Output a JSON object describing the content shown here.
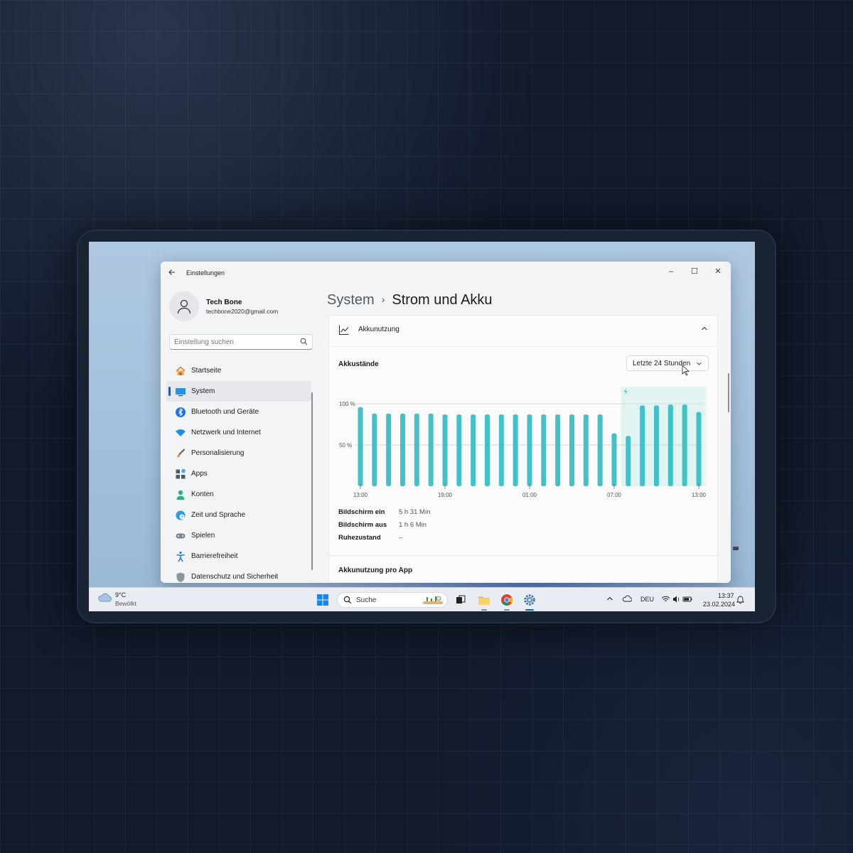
{
  "window": {
    "app_title": "Einstellungen",
    "controls": {
      "minimize": "–",
      "maximize": "☐",
      "close": "✕"
    }
  },
  "user": {
    "name": "Tech Bone",
    "email": "techbone2020@gmail.com"
  },
  "search": {
    "placeholder": "Einstellung suchen"
  },
  "sidebar": {
    "items": [
      {
        "label": "Startseite",
        "icon": "home-icon",
        "active": false
      },
      {
        "label": "System",
        "icon": "monitor-icon",
        "active": true
      },
      {
        "label": "Bluetooth und Geräte",
        "icon": "bluetooth-icon",
        "active": false
      },
      {
        "label": "Netzwerk und Internet",
        "icon": "wifi-icon",
        "active": false
      },
      {
        "label": "Personalisierung",
        "icon": "brush-icon",
        "active": false
      },
      {
        "label": "Apps",
        "icon": "apps-icon",
        "active": false
      },
      {
        "label": "Konten",
        "icon": "person-icon",
        "active": false
      },
      {
        "label": "Zeit und Sprache",
        "icon": "globe-clock-icon",
        "active": false
      },
      {
        "label": "Spielen",
        "icon": "gamepad-icon",
        "active": false
      },
      {
        "label": "Barrierefreiheit",
        "icon": "accessibility-icon",
        "active": false
      },
      {
        "label": "Datenschutz und Sicherheit",
        "icon": "shield-icon",
        "active": false
      }
    ]
  },
  "breadcrumb": {
    "parent": "System",
    "separator": "›",
    "current": "Strom und Akku"
  },
  "battery_card": {
    "header_title": "Akkunutzung",
    "levels_title": "Akkustände",
    "range_selector": "Letzte 24 Stunden",
    "stats": [
      {
        "label": "Bildschirm ein",
        "value": "5 h 31 Min"
      },
      {
        "label": "Bildschirm aus",
        "value": "1 h 6 Min"
      },
      {
        "label": "Ruhezustand",
        "value": "–"
      }
    ],
    "per_app_title": "Akkunutzung pro App"
  },
  "chart_data": {
    "type": "bar",
    "x_tick_labels": [
      "13:00",
      "19:00",
      "01:00",
      "07:00",
      "13:00"
    ],
    "y_tick_labels": [
      "100 %",
      "50 %"
    ],
    "ylim": [
      0,
      100
    ],
    "values": [
      96,
      88,
      88,
      88,
      88,
      88,
      87,
      87,
      87,
      87,
      87,
      87,
      87,
      87,
      87,
      87,
      87,
      87,
      64,
      61,
      98,
      98,
      99,
      99,
      90
    ],
    "charging_start_index": 19,
    "bar_color": "#41c1c8",
    "charging_band_color": "#e1f4f2"
  },
  "taskbar": {
    "weather": {
      "temp": "9°C",
      "desc": "Bewölkt"
    },
    "search_label": "Suche",
    "language": "DEU",
    "time": "13:37",
    "date": "23.02.2024"
  },
  "colors": {
    "accent": "#0067c0",
    "bar": "#41c1c8"
  }
}
